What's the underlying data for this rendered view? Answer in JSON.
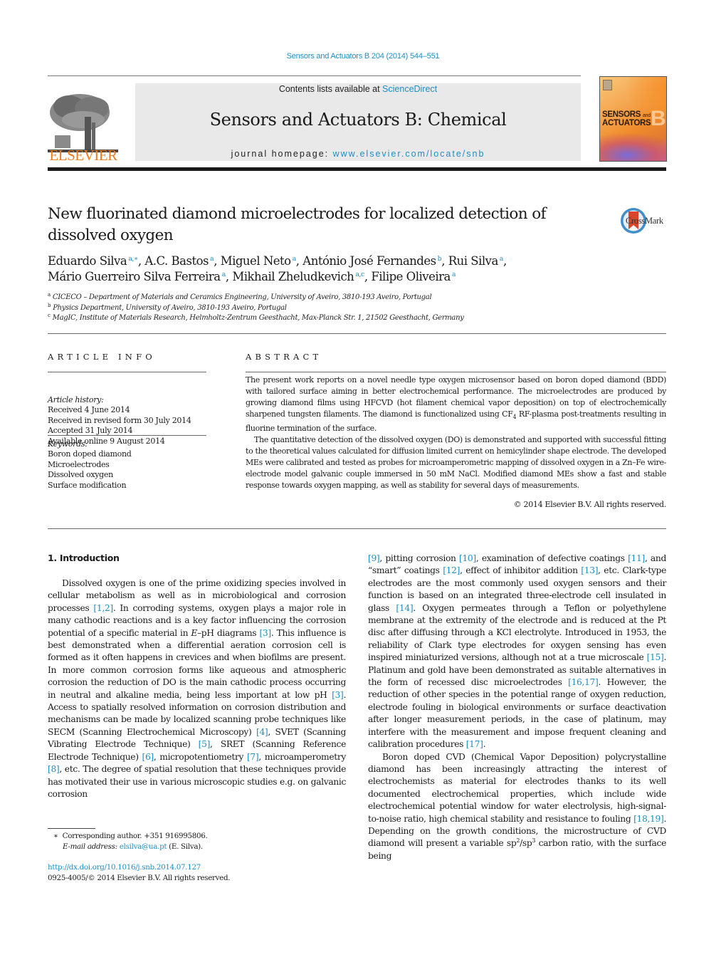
{
  "header": {
    "journal_ref": "Sensors and Actuators B 204 (2014) 544–551",
    "contents_prefix": "Contents lists available at ",
    "contents_link": "ScienceDirect",
    "journal_title": "Sensors and Actuators B: Chemical",
    "homepage_prefix": "journal homepage: ",
    "homepage_link": "www.elsevier.com/locate/snb",
    "publisher_logo_text": "ELSEVIER",
    "cover": {
      "title_line1": "SENSORS",
      "title_and": "and",
      "title_line2": "ACTUATORS",
      "letter": "B"
    },
    "crossmark_label": "CrossMark"
  },
  "article": {
    "title": "New fluorinated diamond microelectrodes for localized detection of dissolved oxygen",
    "authors": [
      {
        "name": "Eduardo Silva",
        "aff": "a,∗"
      },
      {
        "name": "A.C. Bastos",
        "aff": "a"
      },
      {
        "name": "Miguel Neto",
        "aff": "a"
      },
      {
        "name": "António José Fernandes",
        "aff": "b"
      },
      {
        "name": "Rui Silva",
        "aff": "a"
      },
      {
        "name": "Mário Guerreiro Silva Ferreira",
        "aff": "a"
      },
      {
        "name": "Mikhail Zheludkevich",
        "aff": "a,c"
      },
      {
        "name": "Filipe Oliveira",
        "aff": "a"
      }
    ],
    "affiliations": [
      {
        "key": "a",
        "text": "CICECO – Department of Materials and Ceramics Engineering, University of Aveiro, 3810-193 Aveiro, Portugal"
      },
      {
        "key": "b",
        "text": "Physics Department, University of Aveiro, 3810-193 Aveiro, Portugal"
      },
      {
        "key": "c",
        "text": "MagIC, Institute of Materials Research, Helmholtz-Zentrum Geesthacht, Max-Planck Str. 1, 21502 Geesthacht, Germany"
      }
    ]
  },
  "article_info": {
    "heading": "ARTICLE INFO",
    "history_label": "Article history:",
    "history": [
      "Received 4 June 2014",
      "Received in revised form 30 July 2014",
      "Accepted 31 July 2014",
      "Available online 9 August 2014"
    ],
    "keywords_label": "Keywords:",
    "keywords": [
      "Boron doped diamond",
      "Microelectrodes",
      "Dissolved oxygen",
      "Surface modification"
    ]
  },
  "abstract": {
    "heading": "ABSTRACT",
    "p1_a": "The present work reports on a novel needle type oxygen microsensor based on boron doped diamond (BDD) with tailored surface aiming in better electrochemical performance. The microelectrodes are produced by growing diamond films using HFCVD (hot filament chemical vapor deposition) on top of electrochemically sharpened tungsten filaments. The diamond is functionalized using CF",
    "p1_sub": "4",
    "p1_b": " RF-plasma post-treatments resulting in fluorine termination of the surface.",
    "p2": "The quantitative detection of the dissolved oxygen (DO) is demonstrated and supported with successful fitting to the theoretical values calculated for diffusion limited current on hemicylinder shape electrode. The developed MEs were calibrated and tested as probes for microamperometric mapping of dissolved oxygen in a Zn–Fe wire-electrode model galvanic couple immersed in 50 mM NaCl. Modified diamond MEs show a fast and stable response towards oxygen mapping, as well as stability for several days of measurements.",
    "copyright": "© 2014 Elsevier B.V. All rights reserved."
  },
  "intro": {
    "heading": "1.  Introduction",
    "left": [
      {
        "t": "Dissolved oxygen is one of the prime oxidizing species involved in cellular metabolism as well as in microbiological and corrosion processes "
      },
      {
        "r": "[1,2]"
      },
      {
        "t": ". In corroding systems, oxygen plays a major role in many cathodic reactions and is a key factor influencing the corrosion potential of a specific material in "
      },
      {
        "i": "E"
      },
      {
        "t": "–pH diagrams "
      },
      {
        "r": "[3]"
      },
      {
        "t": ". This influence is best demonstrated when a differential aeration corrosion cell is formed as it often happens in crevices and when biofilms are present. In more common corrosion forms like aqueous and atmospheric corrosion the reduction of DO is the main cathodic process occurring in neutral and alkaline media, being less important at low pH "
      },
      {
        "r": "[3]"
      },
      {
        "t": ". Access to spatially resolved information on corrosion distribution and mechanisms can be made by localized scanning probe techniques like SECM (Scanning Electrochemical Microscopy) "
      },
      {
        "r": "[4]"
      },
      {
        "t": ", SVET (Scanning Vibrating Electrode Technique) "
      },
      {
        "r": "[5]"
      },
      {
        "t": ", SRET (Scanning Reference Electrode Technique) "
      },
      {
        "r": "[6]"
      },
      {
        "t": ", micropotentiometry "
      },
      {
        "r": "[7]"
      },
      {
        "t": ", microamperometry "
      },
      {
        "r": "[8]"
      },
      {
        "t": ", etc. The degree of spatial resolution that these techniques provide has motivated their use in various microscopic studies e.g. on galvanic corrosion"
      }
    ],
    "right_p1": [
      {
        "r": "[9]"
      },
      {
        "t": ", pitting corrosion "
      },
      {
        "r": "[10]"
      },
      {
        "t": ", examination of defective coatings "
      },
      {
        "r": "[11]"
      },
      {
        "t": ", and “smart” coatings "
      },
      {
        "r": "[12]"
      },
      {
        "t": ", effect of inhibitor addition "
      },
      {
        "r": "[13]"
      },
      {
        "t": ", etc. Clark-type electrodes are the most commonly used oxygen sensors and their function is based on an integrated three-electrode cell insulated in glass "
      },
      {
        "r": "[14]"
      },
      {
        "t": ". Oxygen permeates through a Teflon or polyethylene membrane at the extremity of the electrode and is reduced at the Pt disc after diffusing through a KCl electrolyte. Introduced in 1953, the reliability of Clark type electrodes for oxygen sensing has even inspired miniaturized versions, although not at a true microscale "
      },
      {
        "r": "[15]"
      },
      {
        "t": ". Platinum and gold have been demonstrated as suitable alternatives in the form of recessed disc microelectrodes "
      },
      {
        "r": "[16,17]"
      },
      {
        "t": ". However, the reduction of other species in the potential range of oxygen reduction, electrode fouling in biological environments or surface deactivation after longer measurement periods, in the case of platinum, may interfere with the measurement and impose frequent cleaning and calibration procedures "
      },
      {
        "r": "[17]"
      },
      {
        "t": "."
      }
    ],
    "right_p2": [
      {
        "t": "Boron doped CVD (Chemical Vapor Deposition) polycrystalline diamond has been increasingly attracting the interest of electrochemists as material for electrodes thanks to its well documented electrochemical properties, which include wide electrochemical potential window for water electrolysis, high-signal-to-noise ratio, high chemical stability and resistance to fouling "
      },
      {
        "r": "[18,19]"
      },
      {
        "t": ". Depending on the growth conditions, the microstructure of CVD diamond will present a variable sp"
      },
      {
        "s": "2"
      },
      {
        "t": "/sp"
      },
      {
        "s": "3"
      },
      {
        "t": " carbon ratio, with the surface being"
      }
    ]
  },
  "footnote": {
    "marker": "∗",
    "corresponding": "Corresponding author. +351 916995806.",
    "email_label": "E-mail address:",
    "email": "elsilva@ua.pt",
    "email_suffix": " (E. Silva).",
    "doi": "http://dx.doi.org/10.1016/j.snb.2014.07.127",
    "issn_copyright": "0925-4005/© 2014 Elsevier B.V. All rights reserved."
  },
  "colors": {
    "link": "#1e8ec4",
    "elsevier_orange": "#f07b1a",
    "masthead_gray": "#e9e9e9"
  }
}
